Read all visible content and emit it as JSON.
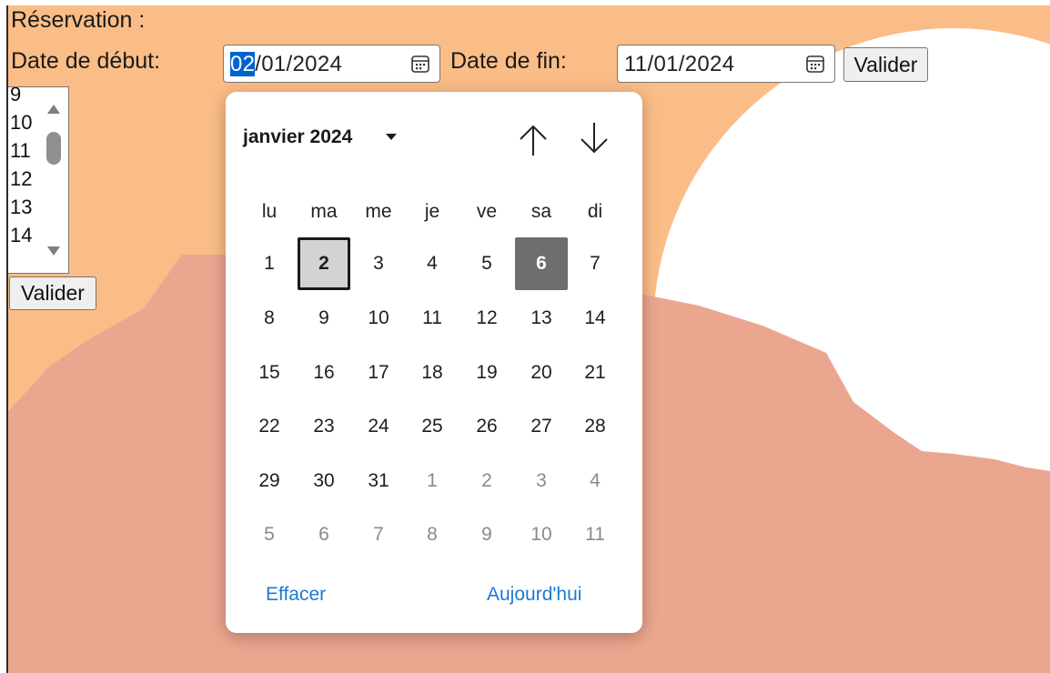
{
  "title": "Réservation :",
  "start": {
    "label": "Date de début:",
    "day": "02",
    "rest": "/01/2024"
  },
  "end": {
    "label": "Date de fin:",
    "value": "11/01/2024"
  },
  "validate_label": "Valider",
  "listbox": {
    "options": [
      "9",
      "10",
      "11",
      "12",
      "13",
      "14"
    ]
  },
  "calendar": {
    "month_label": "janvier 2024",
    "weekdays": [
      "lu",
      "ma",
      "me",
      "je",
      "ve",
      "sa",
      "di"
    ],
    "weeks": [
      [
        {
          "d": "1"
        },
        {
          "d": "2",
          "selected": true
        },
        {
          "d": "3"
        },
        {
          "d": "4"
        },
        {
          "d": "5"
        },
        {
          "d": "6",
          "today": true
        },
        {
          "d": "7"
        }
      ],
      [
        {
          "d": "8"
        },
        {
          "d": "9"
        },
        {
          "d": "10"
        },
        {
          "d": "11"
        },
        {
          "d": "12"
        },
        {
          "d": "13"
        },
        {
          "d": "14"
        }
      ],
      [
        {
          "d": "15"
        },
        {
          "d": "16"
        },
        {
          "d": "17"
        },
        {
          "d": "18"
        },
        {
          "d": "19"
        },
        {
          "d": "20"
        },
        {
          "d": "21"
        }
      ],
      [
        {
          "d": "22"
        },
        {
          "d": "23"
        },
        {
          "d": "24"
        },
        {
          "d": "25"
        },
        {
          "d": "26"
        },
        {
          "d": "27"
        },
        {
          "d": "28"
        }
      ],
      [
        {
          "d": "29"
        },
        {
          "d": "30"
        },
        {
          "d": "31"
        },
        {
          "d": "1",
          "other": true
        },
        {
          "d": "2",
          "other": true
        },
        {
          "d": "3",
          "other": true
        },
        {
          "d": "4",
          "other": true
        }
      ],
      [
        {
          "d": "5",
          "other": true
        },
        {
          "d": "6",
          "other": true
        },
        {
          "d": "7",
          "other": true
        },
        {
          "d": "8",
          "other": true
        },
        {
          "d": "9",
          "other": true
        },
        {
          "d": "10",
          "other": true
        },
        {
          "d": "11",
          "other": true
        }
      ]
    ],
    "clear_label": "Effacer",
    "today_label": "Aujourd'hui"
  },
  "colors": {
    "sky": "#fbbd87",
    "mountain": "#eba68f",
    "sun": "#ffffff",
    "selection": "#0063d1",
    "link": "#1f7ad1",
    "today_bg": "#6e6e6e"
  },
  "icons": {
    "calendar": "calendar-icon",
    "scroll_up": "triangle-up-icon",
    "scroll_down": "triangle-down-icon",
    "month_dropdown": "caret-down-icon",
    "prev_month": "arrow-up-icon",
    "next_month": "arrow-down-icon"
  }
}
